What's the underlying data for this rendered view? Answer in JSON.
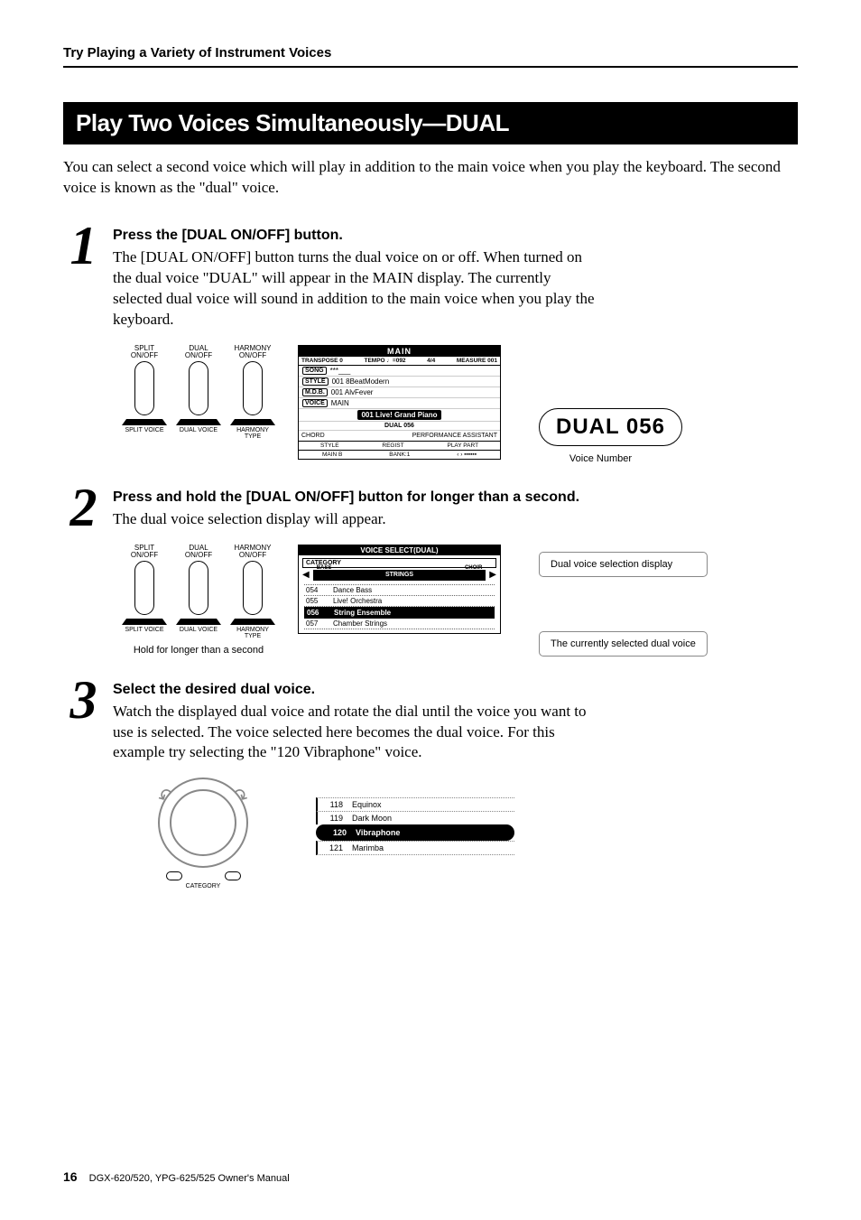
{
  "header": {
    "section": "Try Playing a Variety of Instrument Voices"
  },
  "title": "Play Two Voices Simultaneously—DUAL",
  "intro": "You can select a second voice which will play in addition to the main voice when you play the keyboard. The second voice is known as the \"dual\" voice.",
  "steps": [
    {
      "num": "1",
      "heading": "Press the [DUAL ON/OFF] button.",
      "body": "The [DUAL ON/OFF] button turns the dual voice on or off.\nWhen turned on the dual voice \"DUAL\" will appear in the MAIN display. The currently selected dual voice will sound in addition to the main voice when you play the keyboard."
    },
    {
      "num": "2",
      "heading": "Press and hold the [DUAL ON/OFF] button for longer than a second.",
      "body": "The dual voice selection display will appear."
    },
    {
      "num": "3",
      "heading": "Select the desired dual voice.",
      "body": "Watch the displayed dual voice and rotate the dial until the voice you want to use is selected. The voice selected here becomes the dual voice. For this example try selecting the \"120 Vibraphone\" voice."
    }
  ],
  "panel_buttons": {
    "top_labels": [
      "SPLIT\nON/OFF",
      "DUAL\nON/OFF",
      "HARMONY\nON/OFF"
    ],
    "bottom_labels": [
      "SPLIT\nVOICE",
      "DUAL\nVOICE",
      "HARMONY\nTYPE"
    ]
  },
  "fig1_caption_hold": "Hold for longer than a second",
  "lcd_main": {
    "title": "MAIN",
    "transpose": "TRANSPOSE 0",
    "tempo": "TEMPO ♩=092",
    "timesig": "4/4",
    "measure": "MEASURE 001",
    "song": "***___",
    "style": "001 8BeatModern",
    "mdb": "001 AlvFever",
    "voice_label": "MAIN",
    "voice_name": "001 Live! Grand Piano",
    "dual_line": "DUAL 056",
    "chord": "CHORD",
    "perf": "PERFORMANCE ASSISTANT",
    "bottom_style": "STYLE",
    "bottom_regist": "REGIST",
    "bottom_playpart": "PLAY PART",
    "mainb": "MAIN B",
    "bank": "BANK:1"
  },
  "dual_badge": "DUAL 056",
  "dual_badge_label": "Voice Number",
  "lcd_select": {
    "title": "VOICE SELECT(DUAL)",
    "category_label": "CATEGORY",
    "cat_left": "BASS",
    "cat_center": "STRINGS",
    "cat_right": "CHOIR",
    "items": [
      {
        "num": "054",
        "name": "Dance Bass"
      },
      {
        "num": "055",
        "name": "Live! Orchestra"
      },
      {
        "num": "056",
        "name": "String Ensemble",
        "selected": true
      },
      {
        "num": "057",
        "name": "Chamber Strings"
      }
    ]
  },
  "side_labels": {
    "a": "Dual voice selection display",
    "b": "The currently selected dual voice"
  },
  "dial_caption": "CATEGORY",
  "lcd3_items": [
    {
      "num": "118",
      "name": "Equinox"
    },
    {
      "num": "119",
      "name": "Dark Moon"
    },
    {
      "num": "120",
      "name": "Vibraphone",
      "selected": true
    },
    {
      "num": "121",
      "name": "Marimba"
    }
  ],
  "footer": {
    "page": "16",
    "manual": "DGX-620/520, YPG-625/525  Owner's Manual"
  }
}
